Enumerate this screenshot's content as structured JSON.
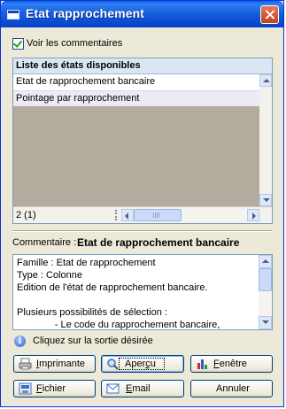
{
  "window": {
    "title": "Etat rapprochement"
  },
  "options": {
    "show_comments_label": "Voir les commentaires",
    "show_comments_checked": true
  },
  "list": {
    "header": "Liste des états disponibles",
    "items": [
      "Etat de rapprochement bancaire",
      "Pointage par rapprochement"
    ],
    "count": "2 (1)"
  },
  "comment": {
    "label": "Commentaire :",
    "title": "Etat de rapprochement bancaire",
    "lines": [
      "Famille : Etat de rapprochement",
      "Type : Colonne",
      "Edition de l'état de rapprochement bancaire.",
      "",
      "Plusieurs possibilités de sélection :",
      "              - Le code du rapprochement bancaire,"
    ]
  },
  "hint": "Cliquez sur la sortie désirée",
  "buttons": {
    "imprimante": {
      "underline": "I",
      "rest": "mprimante"
    },
    "apercu": {
      "pre": "Aper",
      "underline": "ç",
      "post": "u"
    },
    "fenetre": {
      "underline": "F",
      "rest": "enêtre"
    },
    "fichier": {
      "underline": "F",
      "rest": "ichier"
    },
    "email": {
      "underline": "E",
      "rest": "mail"
    },
    "annuler": "Annuler"
  },
  "colors": {
    "titlebar": "#0b4fd4",
    "dialog_bg": "#ece9d8",
    "list_empty_bg": "#b3ab9d",
    "list_header_bg": "#dbe6f5"
  },
  "icons": {
    "title": "window-icon",
    "close": "close-icon",
    "info": "info-icon",
    "imprimante": "printer-icon",
    "apercu": "preview-icon",
    "fenetre": "window-chart-icon",
    "fichier": "file-icon",
    "email": "email-icon"
  }
}
